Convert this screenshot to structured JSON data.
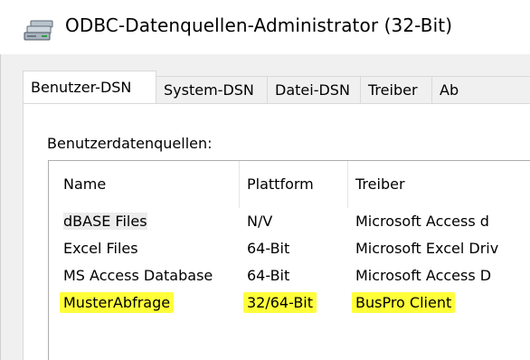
{
  "window": {
    "title": "ODBC-Datenquellen-Administrator (32-Bit)",
    "icon": "odbc-datasource-icon"
  },
  "tabs": [
    {
      "label": "Benutzer-DSN",
      "active": true
    },
    {
      "label": "System-DSN",
      "active": false
    },
    {
      "label": "Datei-DSN",
      "active": false
    },
    {
      "label": "Treiber",
      "active": false
    },
    {
      "label": "Ab",
      "active": false
    }
  ],
  "panel": {
    "section_label": "Benutzerdatenquellen:"
  },
  "list": {
    "columns": [
      "Name",
      "Plattform",
      "Treiber"
    ],
    "rows": [
      {
        "name": "dBASE Files",
        "platform": "N/V",
        "driver": "Microsoft Access d"
      },
      {
        "name": "Excel Files",
        "platform": "64-Bit",
        "driver": "Microsoft Excel Driv"
      },
      {
        "name": "MS Access Database",
        "platform": "64-Bit",
        "driver": "Microsoft Access D"
      },
      {
        "name": "MusterAbfrage",
        "platform": "32/64-Bit",
        "driver": "BusPro Client"
      }
    ],
    "selected_row": 0,
    "highlighted_row": 3
  },
  "colors": {
    "highlight": "#ffff3a",
    "window_bg": "#f0f0f0",
    "panel_bg": "#ffffff"
  }
}
